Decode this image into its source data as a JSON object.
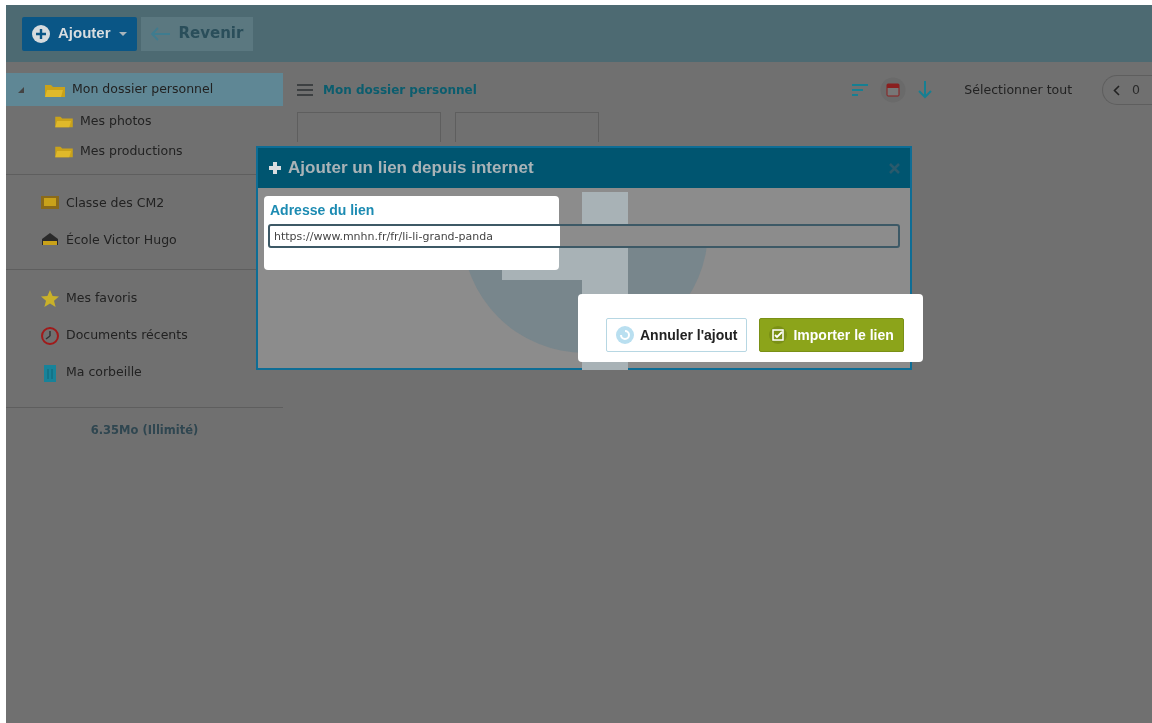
{
  "toolbar": {
    "add_button": {
      "label": "Ajouter"
    },
    "back_button": {
      "label": "Revenir",
      "disabled": true
    }
  },
  "sidebar": {
    "tree": [
      {
        "label": "Mon dossier personnel",
        "selected": true,
        "expanded": true,
        "children": [
          {
            "label": "Mes photos",
            "selected": false
          },
          {
            "label": "Mes productions",
            "selected": false
          }
        ]
      }
    ],
    "shared": [
      {
        "label": "Classe des CM2",
        "kind": "class",
        "selected": false
      },
      {
        "label": "École Victor Hugo",
        "kind": "school",
        "selected": false
      }
    ],
    "links": [
      {
        "label": "Mes favoris",
        "kind": "favorites",
        "selected": false
      },
      {
        "label": "Documents récents",
        "kind": "recent",
        "selected": false
      },
      {
        "label": "Ma corbeille",
        "kind": "trash",
        "selected": false
      }
    ],
    "quota": "6.35Mo (Illimité)"
  },
  "content": {
    "title": "Mon dossier personnel",
    "select_all": "Sélectionner tout",
    "pager": "0"
  },
  "dialog": {
    "title": "Ajouter un lien depuis internet",
    "field_label": "Adresse du lien",
    "field_value": "https://www.mnhn.fr/fr/li-li-grand-panda",
    "buttons": [
      {
        "label": "Annuler l'ajout",
        "kind": "cancel"
      },
      {
        "label": "Importer le lien",
        "kind": "confirm"
      }
    ]
  }
}
